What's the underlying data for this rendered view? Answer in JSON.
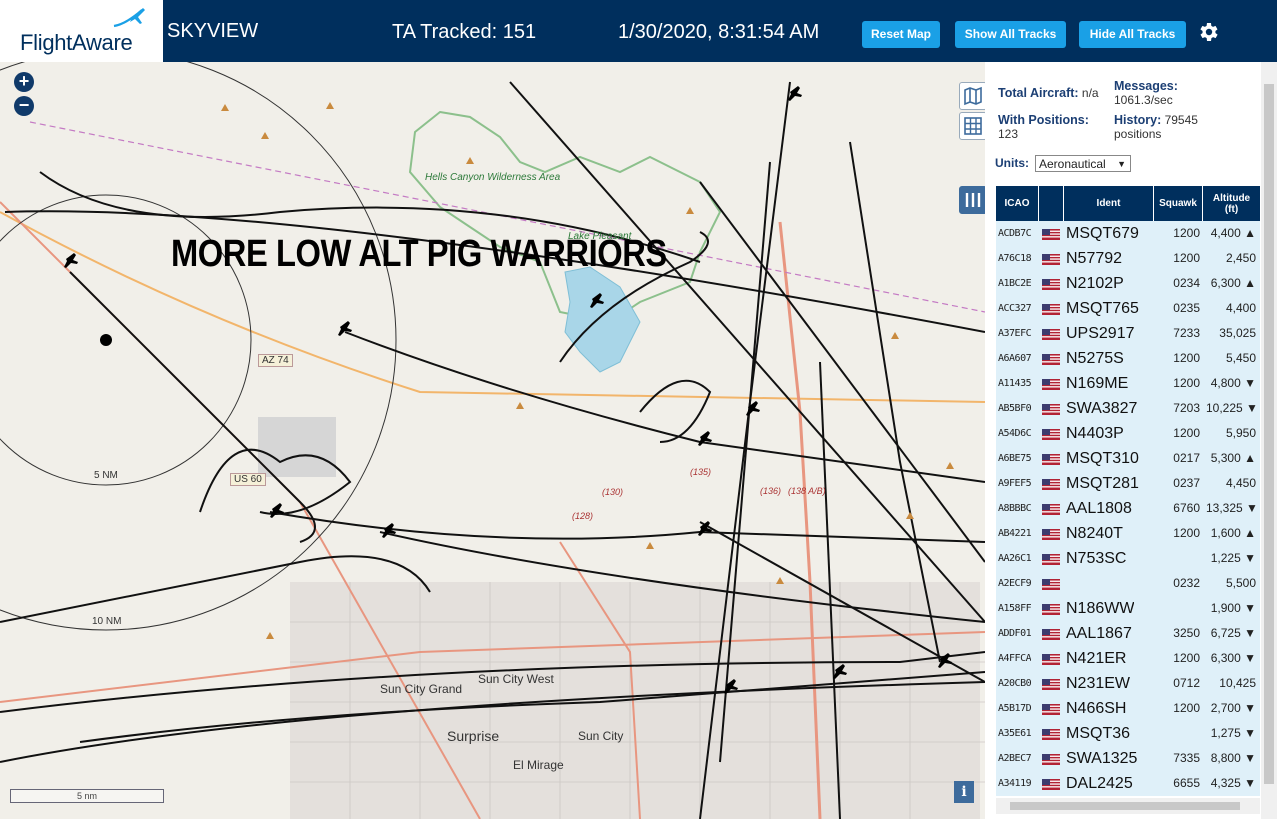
{
  "header": {
    "logo_text": "FlightAware",
    "app_title": "SKYVIEW",
    "tracked": "TA Tracked: 151",
    "datetime": "1/30/2020, 8:31:54 AM",
    "buttons": {
      "reset": "Reset Map",
      "show": "Show All Tracks",
      "hide": "Hide All Tracks"
    }
  },
  "map": {
    "overlay_text": "MORE LOW ALT PIG WARRIORS",
    "zoom_in": "+",
    "zoom_out": "−",
    "scale_label": "5 nm",
    "info_label": "i",
    "labels": {
      "hells_canyon": "Hells Canyon Wilderness Area",
      "lake_pleasant": "Lake Pleasant",
      "az74": "AZ 74",
      "us60": "US 60",
      "ring5": "5 NM",
      "ring10": "10 NM",
      "sun_city_grand": "Sun City Grand",
      "sun_city_west": "Sun City West",
      "sun_city": "Sun City",
      "surprise": "Surprise",
      "el_mirage": "El Mirage",
      "r135": "(135)",
      "r130": "(130)",
      "r136": "(136)",
      "r138": "(138 A/B)",
      "r128": "(128)"
    }
  },
  "stats": {
    "total_label": "Total Aircraft:",
    "total_value": "n/a",
    "messages_label": "Messages:",
    "messages_value": "1061.3/sec",
    "positions_label": "With Positions:",
    "positions_value": "123",
    "history_label": "History:",
    "history_value": "79545 positions"
  },
  "units": {
    "label": "Units:",
    "selected": "Aeronautical"
  },
  "table": {
    "headers": {
      "icao": "ICAO",
      "ident": "Ident",
      "squawk": "Squawk",
      "altitude": "Altitude (ft)"
    },
    "rows": [
      {
        "icao": "ACDB7C",
        "ident": "MSQT679",
        "squawk": "1200",
        "alt": "4,400 ▲"
      },
      {
        "icao": "A76C18",
        "ident": "N57792",
        "squawk": "1200",
        "alt": "2,450"
      },
      {
        "icao": "A1BC2E",
        "ident": "N2102P",
        "squawk": "0234",
        "alt": "6,300 ▲"
      },
      {
        "icao": "ACC327",
        "ident": "MSQT765",
        "squawk": "0235",
        "alt": "4,400"
      },
      {
        "icao": "A37EFC",
        "ident": "UPS2917",
        "squawk": "7233",
        "alt": "35,025"
      },
      {
        "icao": "A6A607",
        "ident": "N5275S",
        "squawk": "1200",
        "alt": "5,450"
      },
      {
        "icao": "A11435",
        "ident": "N169ME",
        "squawk": "1200",
        "alt": "4,800 ▼"
      },
      {
        "icao": "AB5BF0",
        "ident": "SWA3827",
        "squawk": "7203",
        "alt": "10,225 ▼"
      },
      {
        "icao": "A54D6C",
        "ident": "N4403P",
        "squawk": "1200",
        "alt": "5,950"
      },
      {
        "icao": "A6BE75",
        "ident": "MSQT310",
        "squawk": "0217",
        "alt": "5,300 ▲"
      },
      {
        "icao": "A9FEF5",
        "ident": "MSQT281",
        "squawk": "0237",
        "alt": "4,450"
      },
      {
        "icao": "A8BBBC",
        "ident": "AAL1808",
        "squawk": "6760",
        "alt": "13,325 ▼"
      },
      {
        "icao": "AB4221",
        "ident": "N8240T",
        "squawk": "1200",
        "alt": "1,600 ▲"
      },
      {
        "icao": "AA26C1",
        "ident": "N753SC",
        "squawk": "",
        "alt": "1,225 ▼"
      },
      {
        "icao": "A2ECF9",
        "ident": "",
        "squawk": "0232",
        "alt": "5,500"
      },
      {
        "icao": "A158FF",
        "ident": "N186WW",
        "squawk": "",
        "alt": "1,900 ▼"
      },
      {
        "icao": "ADDF01",
        "ident": "AAL1867",
        "squawk": "3250",
        "alt": "6,725 ▼"
      },
      {
        "icao": "A4FFCA",
        "ident": "N421ER",
        "squawk": "1200",
        "alt": "6,300 ▼"
      },
      {
        "icao": "A20CB0",
        "ident": "N231EW",
        "squawk": "0712",
        "alt": "10,425"
      },
      {
        "icao": "A5B17D",
        "ident": "N466SH",
        "squawk": "1200",
        "alt": "2,700 ▼"
      },
      {
        "icao": "A35E61",
        "ident": "MSQT36",
        "squawk": "",
        "alt": "1,275 ▼"
      },
      {
        "icao": "A2BEC7",
        "ident": "SWA1325",
        "squawk": "7335",
        "alt": "8,800 ▼"
      },
      {
        "icao": "A34119",
        "ident": "DAL2425",
        "squawk": "6655",
        "alt": "4,325 ▼"
      }
    ]
  },
  "colors": {
    "header_bg": "#002f5d",
    "button": "#1aa0e6",
    "row_bg": "#dff0f9"
  }
}
